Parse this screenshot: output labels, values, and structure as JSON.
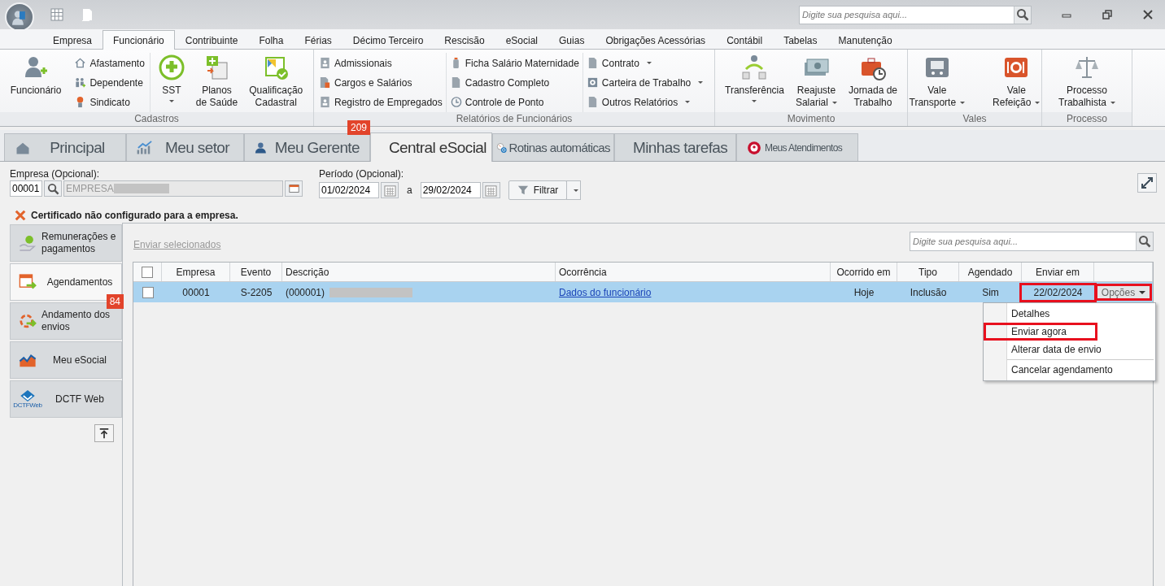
{
  "title_bar": {
    "search": {
      "placeholder": "Digite sua pesquisa aqui..."
    }
  },
  "ribbon": {
    "tabs": [
      {
        "label": "Empresa",
        "selected": false
      },
      {
        "label": "Funcionário",
        "selected": true
      },
      {
        "label": "Contribuinte",
        "selected": false
      },
      {
        "label": "Folha",
        "selected": false
      },
      {
        "label": "Férias",
        "selected": false
      },
      {
        "label": "Décimo Terceiro",
        "selected": false
      },
      {
        "label": "Rescisão",
        "selected": false
      },
      {
        "label": "eSocial",
        "selected": false
      },
      {
        "label": "Guias",
        "selected": false
      },
      {
        "label": "Obrigações Acessórias",
        "selected": false
      },
      {
        "label": "Contábil",
        "selected": false
      },
      {
        "label": "Tabelas",
        "selected": false
      },
      {
        "label": "Manutenção",
        "selected": false
      }
    ],
    "groups": [
      {
        "label": "Cadastros",
        "items": [
          {
            "kind": "large",
            "lines": [
              "Funcionário"
            ],
            "dropdown": false
          },
          {
            "kind": "stack",
            "entries": [
              {
                "label": "Afastamento",
                "dropdown": false
              },
              {
                "label": "Dependente",
                "dropdown": false
              },
              {
                "label": "Sindicato",
                "dropdown": false
              }
            ]
          },
          {
            "kind": "large",
            "lines": [
              "SST"
            ],
            "dropdown": true
          },
          {
            "kind": "large",
            "lines": [
              "Planos",
              "de Saúde"
            ],
            "dropdown": false
          },
          {
            "kind": "large",
            "lines": [
              "Qualificação",
              "Cadastral"
            ],
            "dropdown": false
          }
        ]
      },
      {
        "label": "Relatórios de Funcionários",
        "items": [
          {
            "kind": "stack",
            "entries": [
              {
                "label": "Admissionais",
                "dropdown": false
              },
              {
                "label": "Cargos e Salários",
                "dropdown": false
              },
              {
                "label": "Registro de Empregados",
                "dropdown": false
              }
            ]
          },
          {
            "kind": "stack",
            "entries": [
              {
                "label": "Ficha Salário Maternidade",
                "dropdown": false
              },
              {
                "label": "Cadastro Completo",
                "dropdown": false
              },
              {
                "label": "Controle de Ponto",
                "dropdown": false
              }
            ]
          },
          {
            "kind": "stack",
            "entries": [
              {
                "label": "Contrato",
                "dropdown": true
              },
              {
                "label": "Carteira de Trabalho",
                "dropdown": true
              },
              {
                "label": "Outros Relatórios",
                "dropdown": true
              }
            ]
          }
        ]
      },
      {
        "label": "Movimento",
        "items": [
          {
            "kind": "large",
            "lines": [
              "Transferência"
            ],
            "dropdown": true
          },
          {
            "kind": "large",
            "lines": [
              "Reajuste",
              "Salarial"
            ],
            "dropdown": true
          },
          {
            "kind": "large",
            "lines": [
              "Jornada de",
              "Trabalho"
            ],
            "dropdown": false
          }
        ]
      },
      {
        "label": "Vales",
        "items": [
          {
            "kind": "large",
            "lines": [
              "Vale",
              "Transporte"
            ],
            "dropdown": true
          },
          {
            "kind": "large",
            "lines": [
              "Vale",
              "Refeição"
            ],
            "dropdown": true
          }
        ]
      },
      {
        "label": "Processo",
        "items": [
          {
            "kind": "large",
            "lines": [
              "Processo",
              "Trabalhista"
            ],
            "dropdown": true
          }
        ]
      }
    ]
  },
  "page_tabs": [
    {
      "label": "Principal",
      "selected": false
    },
    {
      "label": "Meu setor",
      "selected": false
    },
    {
      "label": "Meu Gerente",
      "selected": false,
      "badge": "209"
    },
    {
      "label": "Central eSocial",
      "selected": true
    },
    {
      "label": "Rotinas automáticas",
      "selected": false
    },
    {
      "label": "Minhas tarefas",
      "selected": false
    },
    {
      "label": "Meus Atendimentos",
      "selected": false
    }
  ],
  "filters": {
    "empresa": {
      "label": "Empresa (Opcional):",
      "code": "00001",
      "name": "EMPRESA"
    },
    "periodo": {
      "label": "Período (Opcional):",
      "from": "01/02/2024",
      "separator": "a",
      "to": "29/02/2024"
    },
    "filter_button": "Filtrar"
  },
  "warning": "Certificado não configurado para a empresa.",
  "side_tabs": [
    {
      "label": "Remunerações e pagamentos",
      "selected": false
    },
    {
      "label": "Agendamentos",
      "selected": true
    },
    {
      "label": "Andamento dos envios",
      "selected": false,
      "badge": "84"
    },
    {
      "label": "Meu eSocial",
      "selected": false
    },
    {
      "label": "DCTF Web",
      "selected": false,
      "logo_text": "DCTFWeb"
    }
  ],
  "send_selected": "Enviar selecionados",
  "table_search": {
    "placeholder": "Digite sua pesquisa aqui..."
  },
  "table": {
    "select_all": false,
    "columns": [
      "Empresa",
      "Evento",
      "Descrição",
      "Ocorrência",
      "Ocorrido em",
      "Tipo",
      "Agendado",
      "Enviar em"
    ],
    "rows": [
      {
        "checked": false,
        "selected": true,
        "empresa": "00001",
        "evento": "S-2205",
        "descricao": "(000001)",
        "ocorrencia": "Dados do funcionário",
        "ocorrido_em": "Hoje",
        "tipo": "Inclusão",
        "agendado": "Sim",
        "enviar_em": "22/02/2024",
        "enviar_em_highlighted": true,
        "options": {
          "label": "Opções",
          "highlighted": true
        }
      }
    ]
  },
  "options_menu": [
    [
      {
        "label": "Detalhes",
        "highlighted": false
      },
      {
        "label": "Enviar agora",
        "highlighted": true
      },
      {
        "label": "Alterar data de envio",
        "highlighted": false
      }
    ],
    [
      {
        "label": "Cancelar agendamento",
        "highlighted": false
      }
    ]
  ]
}
